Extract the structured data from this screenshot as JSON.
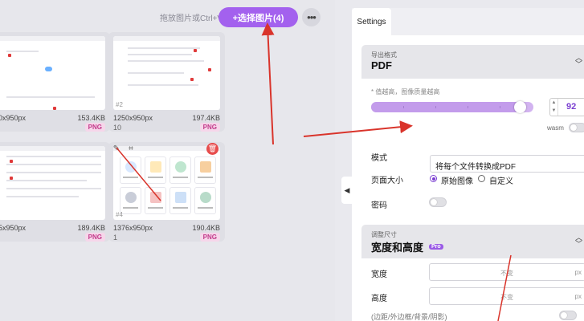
{
  "toolbar": {
    "hint": "拖放图片或Ctrl+V",
    "select_label": "+选择图片(4)",
    "more_label": "•••"
  },
  "cards": [
    {
      "dims": "0x950px",
      "size": "153.4KB",
      "format": "PNG",
      "idx": ""
    },
    {
      "dims": "1250x950px",
      "size": "197.4KB",
      "format": "PNG",
      "idx": "10",
      "thumb_num": "#2"
    },
    {
      "dims": "5x950px",
      "size": "189.4KB",
      "format": "PNG",
      "idx": ""
    },
    {
      "dims": "1376x950px",
      "size": "190.4KB",
      "format": "PNG",
      "idx": "1",
      "thumb_num": "#4"
    }
  ],
  "settings": {
    "tab": "Settings",
    "export": {
      "subtitle": "导出格式",
      "title": "PDF",
      "hint": "* 值越高，图像质量越高",
      "quality": 92,
      "quality_fraction": 0.92,
      "wasm_label": "wasm",
      "mode_label": "模式",
      "mode_value": "将每个文件转换成PDF",
      "page_size_label": "页面大小",
      "page_options": [
        "原始图像",
        "自定义"
      ],
      "page_selected": "原始图像",
      "password_label": "密码"
    },
    "resize": {
      "subtitle": "调整尺寸",
      "title": "宽度和高度",
      "pro": "Pro",
      "width_label": "宽度",
      "height_label": "高度",
      "placeholder": "不变",
      "unit": "px",
      "extra": "(边距/外边框/背景/阴影)"
    }
  },
  "colors": {
    "accent": "#a361ee",
    "badge": "#c23a8a",
    "annotation": "#d9342b"
  }
}
